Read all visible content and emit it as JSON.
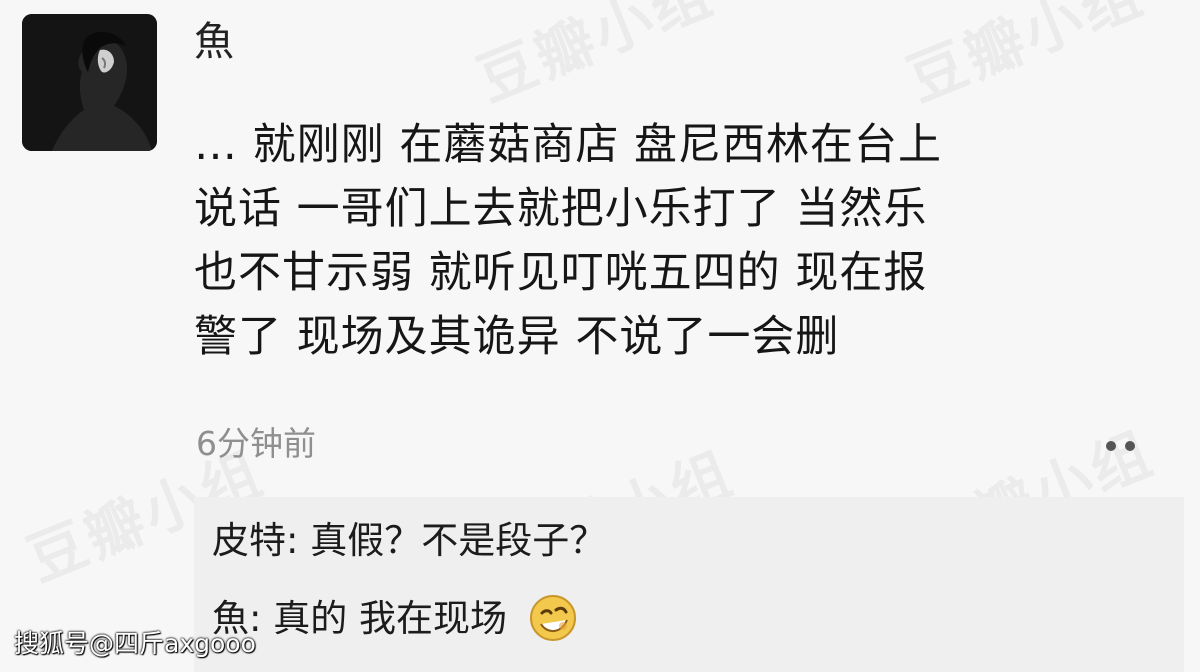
{
  "post": {
    "username": "魚",
    "text": "… 就刚刚 在蘑菇商店 盘尼西林在台上\n说话 一哥们上去就把小乐打了 当然乐\n也不甘示弱 就听见叮咣五四的 现在报\n警了 现场及其诡异 不说了一会删",
    "timestamp": "6分钟前"
  },
  "replies": [
    {
      "author": "皮特",
      "separator": ": ",
      "text": "真假？不是段子？"
    },
    {
      "author": "魚",
      "separator": ": ",
      "text": "真的 我在现场",
      "emoji": "smirk-face-icon"
    }
  ],
  "watermark": "豆瓣小组",
  "credit": "搜狐号@四斤axgooo",
  "colors": {
    "background": "#f7f7f7",
    "reply_background": "#efefef",
    "timestamp": "#8f8f8f"
  }
}
